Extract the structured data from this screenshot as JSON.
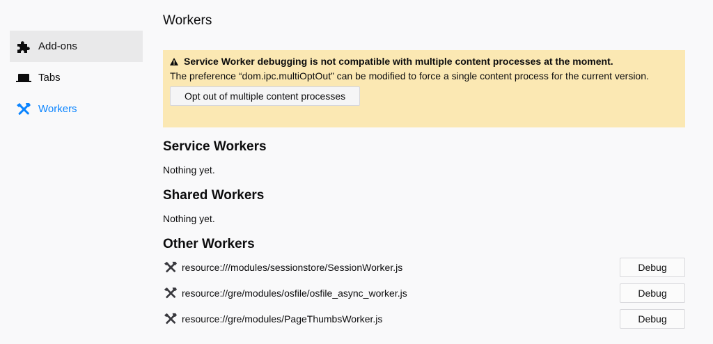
{
  "sidebar": {
    "items": [
      {
        "label": "Add-ons",
        "icon": "puzzle-icon",
        "selected": true
      },
      {
        "label": "Tabs",
        "icon": "tab-icon",
        "selected": false
      },
      {
        "label": "Workers",
        "icon": "hammer-icon",
        "selected": false,
        "active": true
      }
    ]
  },
  "main": {
    "title": "Workers",
    "warning": {
      "icon": "warning-icon",
      "title": "Service Worker debugging is not compatible with multiple content processes at the moment.",
      "text": "The preference “dom.ipc.multiOptOut” can be modified to force a single content process for the current version.",
      "button_label": "Opt out of multiple content processes"
    },
    "service_workers": {
      "heading": "Service Workers",
      "empty_text": "Nothing yet."
    },
    "shared_workers": {
      "heading": "Shared Workers",
      "empty_text": "Nothing yet."
    },
    "other_workers": {
      "heading": "Other Workers",
      "items": [
        {
          "url": "resource:///modules/sessionstore/SessionWorker.js",
          "button_label": "Debug"
        },
        {
          "url": "resource://gre/modules/osfile/osfile_async_worker.js",
          "button_label": "Debug"
        },
        {
          "url": "resource://gre/modules/PageThumbsWorker.js",
          "button_label": "Debug"
        }
      ]
    }
  },
  "colors": {
    "accent": "#0a84ff",
    "warning_bg": "#fbe8b3",
    "page_bg": "#f9f9fa",
    "selected_bg": "#e9e9ea"
  }
}
